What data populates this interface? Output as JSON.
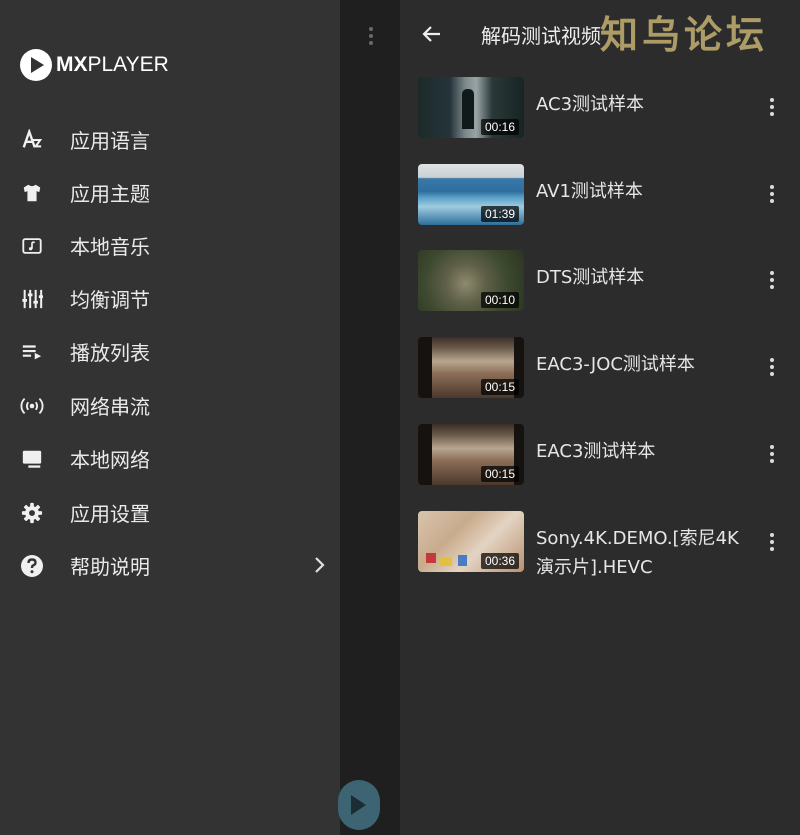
{
  "app": {
    "brand_bold": "MX",
    "brand_rest": "PLAYER"
  },
  "drawer": {
    "items": [
      {
        "label": "应用语言",
        "icon": "language-icon"
      },
      {
        "label": "应用主题",
        "icon": "tshirt-icon"
      },
      {
        "label": "本地音乐",
        "icon": "music-folder-icon"
      },
      {
        "label": "均衡调节",
        "icon": "equalizer-icon"
      },
      {
        "label": "播放列表",
        "icon": "playlist-icon"
      },
      {
        "label": "网络串流",
        "icon": "broadcast-icon"
      },
      {
        "label": "本地网络",
        "icon": "computer-icon"
      },
      {
        "label": "应用设置",
        "icon": "gear-icon"
      },
      {
        "label": "帮助说明",
        "icon": "help-icon"
      }
    ]
  },
  "panel": {
    "title": "解码测试视频",
    "watermark": "知乌论坛",
    "videos": [
      {
        "title": "AC3测试样本",
        "duration": "00:16"
      },
      {
        "title": "AV1测试样本",
        "duration": "01:39"
      },
      {
        "title": "DTS测试样本",
        "duration": "00:10"
      },
      {
        "title": "EAC3-JOC测试样本",
        "duration": "00:15"
      },
      {
        "title": "EAC3测试样本",
        "duration": "00:15"
      },
      {
        "title": "Sony.4K.DEMO.[索尼4K演示片].HEVC",
        "duration": "00:36"
      }
    ]
  },
  "colors": {
    "drawer_bg": "#333333",
    "panel_bg": "#2c2c2c",
    "fab": "#3d6473",
    "watermark": "#d9c27a"
  }
}
